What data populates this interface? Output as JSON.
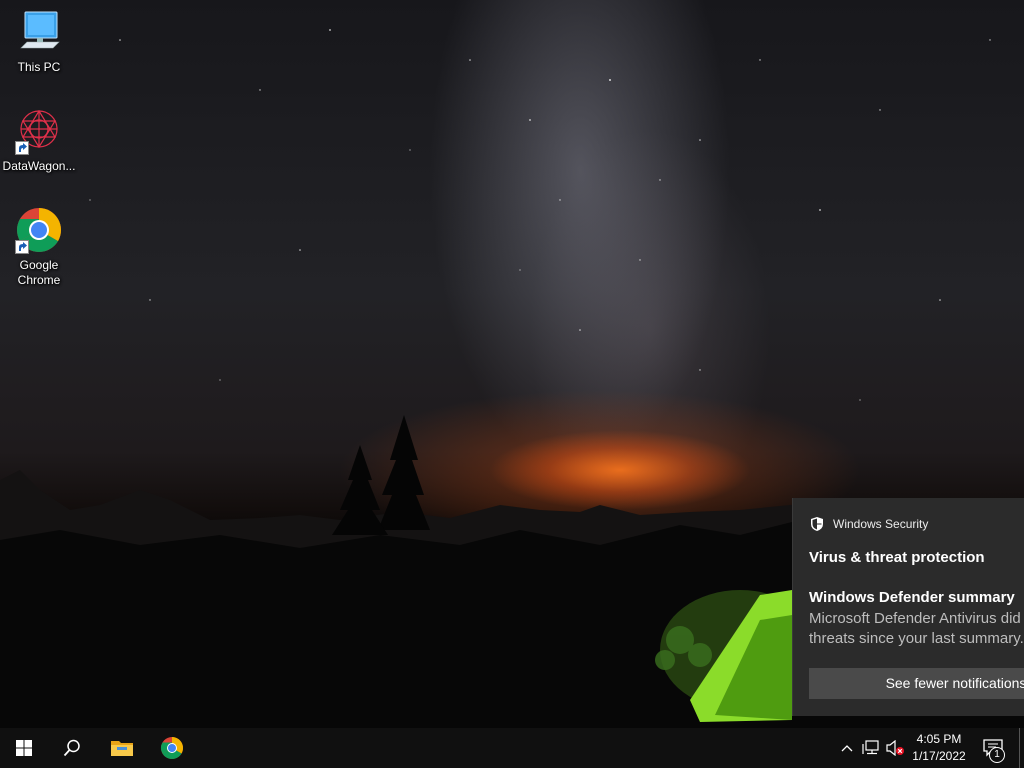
{
  "desktop": {
    "icons": [
      {
        "label": "This PC"
      },
      {
        "label": "DataWagon..."
      },
      {
        "label": "Google Chrome"
      }
    ]
  },
  "notification": {
    "app_name": "Windows Security",
    "heading": "Virus & threat protection",
    "title": "Windows Defender summary",
    "body_line1": "Microsoft Defender Antivirus did",
    "body_line2": "threats since your last summary.",
    "action_label": "See fewer notifications"
  },
  "taskbar": {
    "pinned": [
      {
        "icon": "windows-start-icon"
      },
      {
        "icon": "search-icon"
      },
      {
        "icon": "file-explorer-icon"
      },
      {
        "icon": "chrome-icon"
      }
    ],
    "tray": {
      "time": "4:05 PM",
      "date": "1/17/2022",
      "notification_count": "1"
    }
  },
  "colors": {
    "toast_bg": "#2b2b2b",
    "taskbar_bg": "#101010",
    "button_bg": "#4a4a4a"
  }
}
